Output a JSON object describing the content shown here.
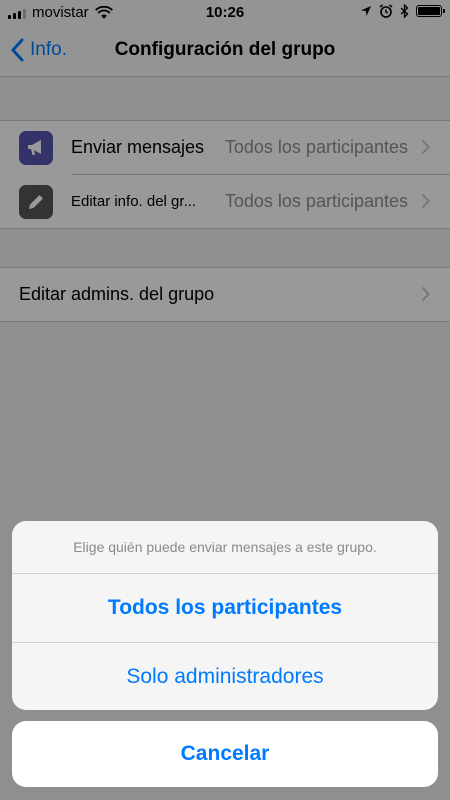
{
  "status_bar": {
    "carrier": "movistar",
    "time": "10:26",
    "icons": [
      "signal-icon",
      "wifi-icon",
      "location-icon",
      "alarm-icon",
      "bluetooth-icon",
      "battery-icon"
    ]
  },
  "nav": {
    "back_label": "Info.",
    "title": "Configuración del grupo"
  },
  "settings": {
    "rows": [
      {
        "label": "Enviar mensajes",
        "value": "Todos los participantes",
        "icon": "megaphone-icon",
        "icon_color": "#5856b0"
      },
      {
        "label": "Editar info. del gr...",
        "value": "Todos los participantes",
        "icon": "pencil-icon",
        "icon_color": "#555555"
      }
    ],
    "admins_label": "Editar admins. del grupo"
  },
  "action_sheet": {
    "message": "Elige quién puede enviar mensajes a este grupo.",
    "options": [
      "Todos los participantes",
      "Solo administradores"
    ],
    "cancel": "Cancelar"
  },
  "colors": {
    "accent": "#007aff",
    "background": "#efeff4"
  }
}
